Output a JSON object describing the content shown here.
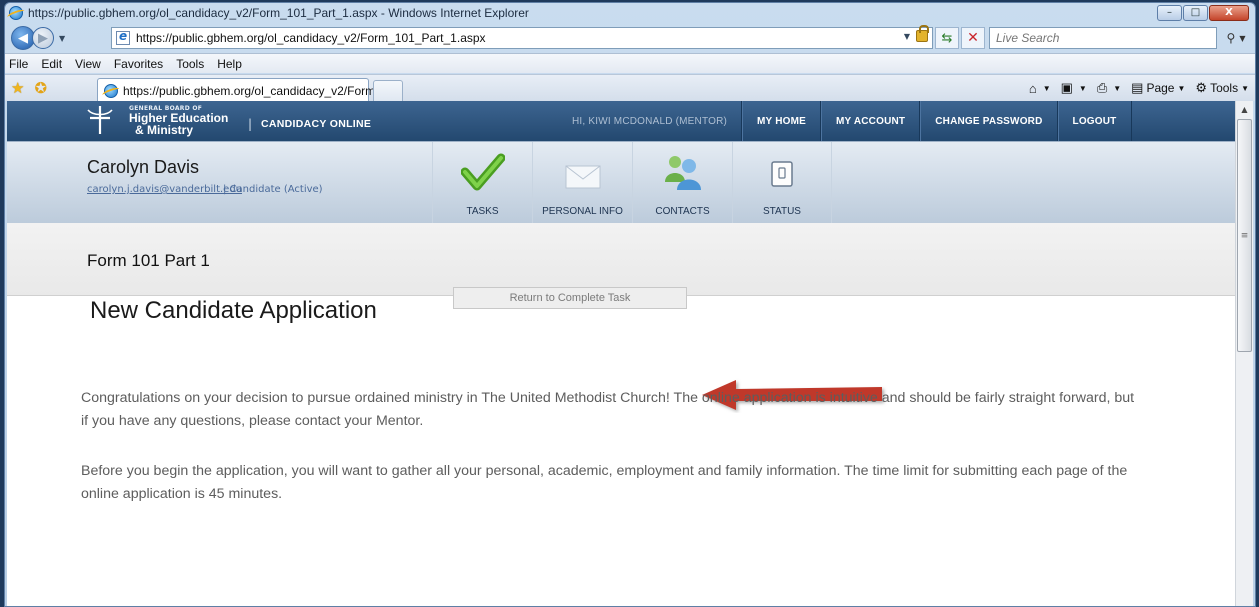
{
  "window": {
    "title": "https://public.gbhem.org/ol_candidacy_v2/Form_101_Part_1.aspx - Windows Internet Explorer",
    "controls": [
      "–",
      "□",
      "X"
    ]
  },
  "address_bar": {
    "url": "https://public.gbhem.org/ol_candidacy_v2/Form_101_Part_1.aspx",
    "search_placeholder": "Live Search"
  },
  "menu": [
    {
      "label": "File"
    },
    {
      "label": "Edit"
    },
    {
      "label": "View"
    },
    {
      "label": "Favorites"
    },
    {
      "label": "Tools"
    },
    {
      "label": "Help"
    }
  ],
  "tabs": {
    "active_title": "https://public.gbhem.org/ol_candidacy_v2/Form..."
  },
  "command_bar": {
    "page_label": "Page",
    "tools_label": "Tools"
  },
  "site": {
    "org_small": "GENERAL BOARD OF",
    "org_line1": "Higher Education",
    "org_line2": "& Ministry",
    "separator": "|",
    "app_name": "CANDIDACY ONLINE",
    "greeting": "HI, KIWI MCDONALD (MENTOR)",
    "nav": [
      {
        "label": "MY HOME"
      },
      {
        "label": "MY ACCOUNT"
      },
      {
        "label": "CHANGE PASSWORD"
      },
      {
        "label": "LOGOUT"
      }
    ]
  },
  "profile": {
    "name": "Carolyn Davis",
    "email": "carolyn.j.davis@vanderbilt.edu",
    "status": "| Candidate (Active)",
    "tabs": [
      {
        "label": "TASKS",
        "icon": "checkmark-icon"
      },
      {
        "label": "PERSONAL INFO",
        "icon": "envelope-icon"
      },
      {
        "label": "CONTACTS",
        "icon": "people-icon"
      },
      {
        "label": "STATUS",
        "icon": "status-icon"
      }
    ]
  },
  "page": {
    "form_title": "Form 101 Part 1",
    "heading": "New Candidate Application",
    "return_button": "Return to Complete Task",
    "paragraph1": "Congratulations on your decision to pursue ordained ministry in The United Methodist Church! The online application is intuitive and should be fairly straight forward, but if you have any questions, please contact your Mentor.",
    "paragraph2": "Before you begin the application, you will want to gather all your personal, academic, employment and family information. The time limit for submitting each page of the online application is 45 minutes."
  },
  "colors": {
    "header_blue": "#2d5582",
    "arrow_red": "#c0392b",
    "check_green": "#5cb82c"
  }
}
